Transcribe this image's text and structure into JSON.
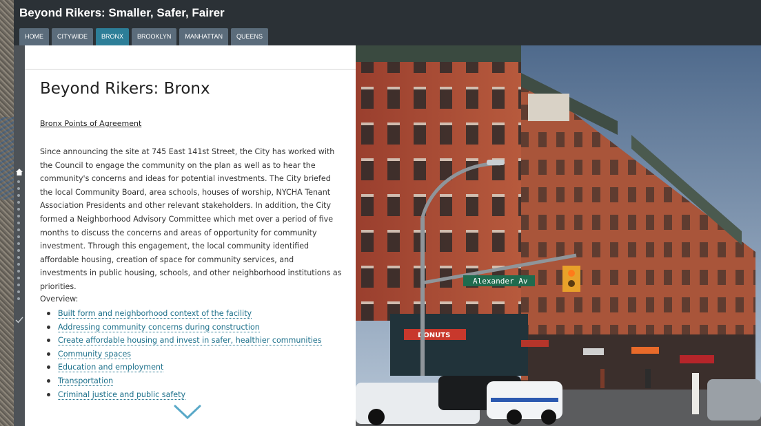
{
  "header": {
    "title": "Beyond Rikers: Smaller, Safer, Fairer",
    "tabs": [
      {
        "label": "HOME"
      },
      {
        "label": "CITYWIDE"
      },
      {
        "label": "BRONX"
      },
      {
        "label": "BROOKLYN"
      },
      {
        "label": "MANHATTAN"
      },
      {
        "label": "QUEENS"
      }
    ],
    "active_tab": "BRONX"
  },
  "main": {
    "title": "Beyond Rikers: Bronx",
    "points_link": "Bronx Points of Agreement",
    "paragraph": "Since announcing the site at 745 East 141st Street, the City has worked with the Council to engage the community on the plan as well as to hear the community's concerns and ideas for potential investments. The City briefed the local Community Board, area schools, houses of worship, NYCHA Tenant Association Presidents and other relevant stakeholders. In addition, the City formed a Neighborhood Advisory Committee which met over a period of five months to discuss the concerns and areas of opportunity for community investment. Through this engagement, the local community identified affordable housing, creation of space for community services, and investments in public housing, schools, and other neighborhood institutions as priorities.",
    "overview_label": "Overview:",
    "overview_items": [
      "Built form and neighborhood context of the facility",
      "Addressing community concerns during construction",
      "Create affordable housing and invest in safer, healthier communities",
      "Community spaces",
      "Education and employment",
      "Transportation",
      "Criminal justice and public safety"
    ]
  },
  "photo": {
    "street_sign": "Alexander Av",
    "storefront_sign": "DONUTS"
  },
  "colors": {
    "header_bg": "#2b3136",
    "tab_bg": "#5b6c7b",
    "tab_active": "#2d7e98",
    "link": "#1b6f8a"
  }
}
